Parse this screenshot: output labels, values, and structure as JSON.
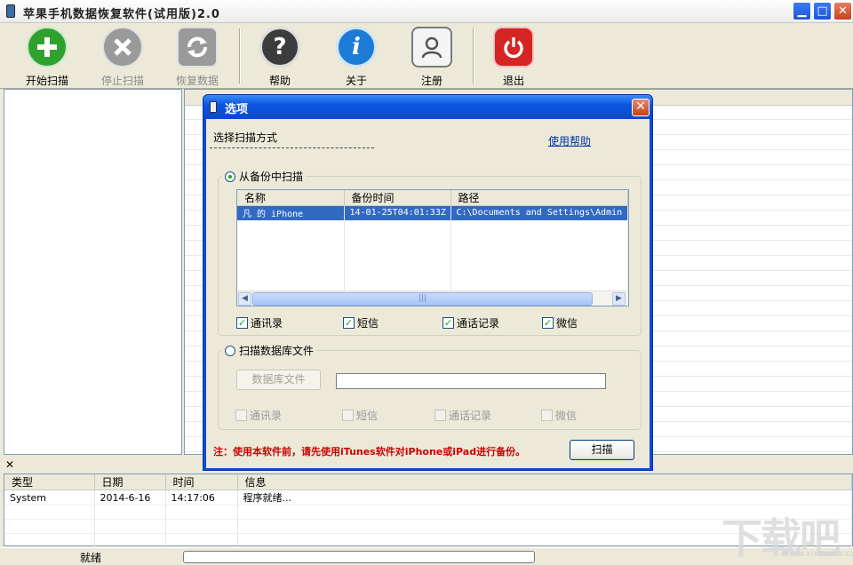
{
  "window": {
    "title": "苹果手机数据恢复软件(试用版)2.0",
    "min_glyph": "▁",
    "max_glyph": "□",
    "close_glyph": "✕"
  },
  "toolbar": {
    "start": "开始扫描",
    "stop": "停止扫描",
    "recover": "恢复数据",
    "help": "帮助",
    "about": "关于",
    "register": "注册",
    "exit": "退出"
  },
  "icons": {
    "start": "plus-icon",
    "stop": "x-icon",
    "recover": "refresh-icon",
    "help": "question-icon",
    "about": "info-icon",
    "register": "user-icon",
    "exit": "power-icon"
  },
  "colors": {
    "start": "#2fa12f",
    "stop": "#9a9a9a",
    "recover": "#9a9a9a",
    "help": "#3c3c3c",
    "about": "#1b7bd6",
    "register": "#6a6a6a",
    "exit": "#d52424"
  },
  "dialog": {
    "title": "选项",
    "scan_mode_label": "选择扫描方式",
    "help_link": "使用帮助",
    "backup_option": "从备份中扫描",
    "columns": [
      "名称",
      "备份时间",
      "路径"
    ],
    "rows": [
      {
        "name": "凡 的 iPhone",
        "time": "14-01-25T04:01:33Z",
        "path": "C:\\Documents and Settings\\Admin"
      }
    ],
    "checks1": [
      "通讯录",
      "短信",
      "通话记录",
      "微信"
    ],
    "db_option": "扫描数据库文件",
    "db_button": "数据库文件",
    "checks2": [
      "通讯录",
      "短信",
      "通话记录",
      "微信"
    ],
    "note": "注：使用本软件前，请先使用iTunes软件对iPhone或iPad进行备份。",
    "scan_button": "扫描",
    "close_glyph": "✕"
  },
  "log": {
    "close_glyph": "✕",
    "columns": [
      "类型",
      "日期",
      "时间",
      "信息"
    ],
    "rows": [
      {
        "type": "System",
        "date": "2014-6-16",
        "time": "14:17:06",
        "info": "程序就绪..."
      }
    ]
  },
  "status": {
    "text": "就绪"
  },
  "watermark": {
    "text": "下载吧",
    "url": "www.xiazaiba.com"
  }
}
